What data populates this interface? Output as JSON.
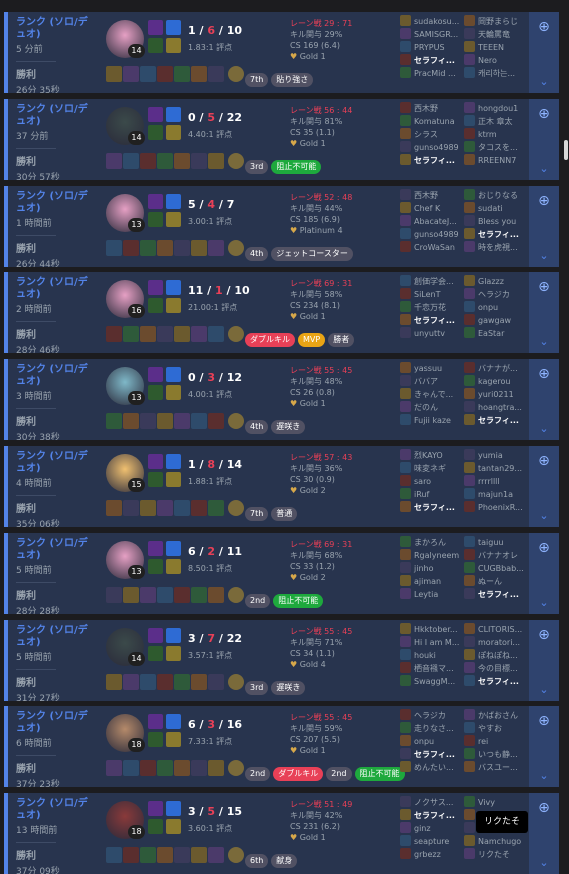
{
  "matches": [
    {
      "queue": "ランク (ソロ/デュオ)",
      "ago": "5 分前",
      "result": "勝利",
      "duration": "26分 35秒",
      "level": "14",
      "kills": "1",
      "deaths": "6",
      "assists": "10",
      "ratio": "1.83:1 評点",
      "placement": "7th",
      "badges": [
        {
          "label": "貼り強さ",
          "kind": "place"
        }
      ],
      "lane": "レーン戦 29 : 71",
      "kp": "キル関与 29%",
      "cs": "CS 169 (6.4)",
      "tier": "Gold 1",
      "team1": [
        "sudakosu...",
        "SAMISGR...",
        "PRYPUS",
        "セラフィ...",
        "PracMid ..."
      ],
      "team2": [
        "岡野まらじ",
        "天輪罵竜",
        "TEEEN",
        "Nero",
        "캐리하는..."
      ],
      "me_index": 3,
      "champ_color": "#e6a0c4"
    },
    {
      "queue": "ランク (ソロ/デュオ)",
      "ago": "37 分前",
      "result": "勝利",
      "duration": "30分 57秒",
      "level": "14",
      "kills": "0",
      "deaths": "5",
      "assists": "22",
      "ratio": "4.40:1 評点",
      "placement": "3rd",
      "badges": [
        {
          "label": "阻止不可能",
          "kind": "green"
        }
      ],
      "lane": "レーン戦 56 : 44",
      "kp": "キル関与 81%",
      "cs": "CS 35 (1.1)",
      "tier": "Gold 1",
      "team1": [
        "西木野",
        "Komatuna",
        "シラス",
        "gunso4989",
        "セラフィ..."
      ],
      "team2": [
        "hongdou1",
        "正木 章太",
        "ktrm",
        "タコスを...",
        "RREENN7"
      ],
      "me_index": 4,
      "champ_color": "#3b4a4a"
    },
    {
      "queue": "ランク (ソロ/デュオ)",
      "ago": "1 時間前",
      "result": "勝利",
      "duration": "26分 44秒",
      "level": "13",
      "kills": "5",
      "deaths": "4",
      "assists": "7",
      "ratio": "3.00:1 評点",
      "placement": "4th",
      "badges": [
        {
          "label": "ジェットコースター",
          "kind": "place"
        }
      ],
      "lane": "レーン戦 52 : 48",
      "kp": "キル関与 44%",
      "cs": "CS 185 (6.9)",
      "tier": "Platinum 4",
      "team1": [
        "西木野",
        "Chef K",
        "AbacateJ...",
        "gunso4989",
        "CroWaSan"
      ],
      "team2": [
        "おじりなる",
        "sudati",
        "Bless you",
        "セラフィ...",
        "時を虎視..."
      ],
      "me_index": 8,
      "champ_color": "#e6a0c4"
    },
    {
      "queue": "ランク (ソロ/デュオ)",
      "ago": "2 時間前",
      "result": "勝利",
      "duration": "28分 46秒",
      "level": "16",
      "kills": "11",
      "deaths": "1",
      "assists": "10",
      "ratio": "21.00:1 評点",
      "placement": "",
      "badges": [
        {
          "label": "ダブルキル",
          "kind": "multi"
        },
        {
          "label": "MVP",
          "kind": "mvp"
        },
        {
          "label": "勝者",
          "kind": "place"
        }
      ],
      "lane": "レーン戦 69 : 31",
      "kp": "キル関与 58%",
      "cs": "CS 234 (8.1)",
      "tier": "Gold 1",
      "team1": [
        "創価学会...",
        "SiLenT",
        "千恋万花",
        "セラフィ...",
        "unyuttv"
      ],
      "team2": [
        "Glazzz",
        "ヘラジカ",
        "onpu",
        "gawgaw",
        "EaStar"
      ],
      "me_index": 3,
      "champ_color": "#e6a0c4"
    },
    {
      "queue": "ランク (ソロ/デュオ)",
      "ago": "3 時間前",
      "result": "勝利",
      "duration": "30分 38秒",
      "level": "13",
      "kills": "0",
      "deaths": "3",
      "assists": "12",
      "ratio": "4.00:1 評点",
      "placement": "4th",
      "badges": [
        {
          "label": "遅咲き",
          "kind": "place"
        }
      ],
      "lane": "レーン戦 55 : 45",
      "kp": "キル関与 48%",
      "cs": "CS 26 (0.8)",
      "tier": "Gold 1",
      "team1": [
        "yassuu",
        "ババア",
        "きゃんで...",
        "だのん",
        "Fujii kaze"
      ],
      "team2": [
        "バナナが...",
        "kagerou",
        "yuri0211",
        "hoangtra...",
        "セラフィ..."
      ],
      "me_index": 9,
      "champ_color": "#7fb8c8"
    },
    {
      "queue": "ランク (ソロ/デュオ)",
      "ago": "4 時間前",
      "result": "勝利",
      "duration": "35分 06秒",
      "level": "15",
      "kills": "1",
      "deaths": "8",
      "assists": "14",
      "ratio": "1.88:1 評点",
      "placement": "7th",
      "badges": [
        {
          "label": "普通",
          "kind": "place"
        }
      ],
      "lane": "レーン戦 57 : 43",
      "kp": "キル関与 36%",
      "cs": "CS 30 (0.9)",
      "tier": "Gold 2",
      "team1": [
        "烈KAYO",
        "味変ネギ",
        "saro",
        "iRuf",
        "セラフィ..."
      ],
      "team2": [
        "yumia",
        "tantan29...",
        "rrrrllll",
        "majun1a",
        "PhoenixR..."
      ],
      "me_index": 4,
      "champ_color": "#f0c070"
    },
    {
      "queue": "ランク (ソロ/デュオ)",
      "ago": "5 時間前",
      "result": "勝利",
      "duration": "28分 28秒",
      "level": "13",
      "kills": "6",
      "deaths": "2",
      "assists": "11",
      "ratio": "8.50:1 評点",
      "placement": "2nd",
      "badges": [
        {
          "label": "阻止不可能",
          "kind": "green"
        }
      ],
      "lane": "レーン戦 69 : 31",
      "kp": "キル関与 68%",
      "cs": "CS 33 (1.2)",
      "tier": "Gold 2",
      "team1": [
        "まかろん",
        "Rgalyneem",
        "jinho",
        "ajiman",
        "Leytia"
      ],
      "team2": [
        "taiguu",
        "バナナオレ",
        "CUGBbab...",
        "ぬーん",
        "セラフィ..."
      ],
      "me_index": 9,
      "champ_color": "#e6a0c4"
    },
    {
      "queue": "ランク (ソロ/デュオ)",
      "ago": "5 時間前",
      "result": "勝利",
      "duration": "31分 27秒",
      "level": "14",
      "kills": "3",
      "deaths": "7",
      "assists": "22",
      "ratio": "3.57:1 評点",
      "placement": "3rd",
      "badges": [
        {
          "label": "遅咲き",
          "kind": "place"
        }
      ],
      "lane": "レーン戦 55 : 45",
      "kp": "キル関与 71%",
      "cs": "CS 34 (1.1)",
      "tier": "Gold 4",
      "team1": [
        "Hkktober...",
        "Hi I am M...",
        "houki",
        "栖音襁マ...",
        "SwaggM..."
      ],
      "team2": [
        "CLITORIS...",
        "moratori...",
        "ぽねぽね...",
        "今の目標...",
        "セラフィ..."
      ],
      "me_index": 9,
      "champ_color": "#3b4a4a"
    },
    {
      "queue": "ランク (ソロ/デュオ)",
      "ago": "6 時間前",
      "result": "勝利",
      "duration": "37分 23秒",
      "level": "18",
      "kills": "6",
      "deaths": "3",
      "assists": "16",
      "ratio": "7.33:1 評点",
      "placement": "2nd",
      "badges": [
        {
          "label": "ダブルキル",
          "kind": "multi"
        },
        {
          "label": "2nd",
          "kind": "place"
        },
        {
          "label": "阻止不可能",
          "kind": "green"
        }
      ],
      "lane": "レーン戦 55 : 45",
      "kp": "キル関与 59%",
      "cs": "CS 207 (5.5)",
      "tier": "Gold 1",
      "team1": [
        "ヘラジカ",
        "走りなさ...",
        "onpu",
        "セラフィ...",
        "めんたい..."
      ],
      "team2": [
        "かばおさん",
        "やすお",
        "rei",
        "いつも静...",
        "バスユー..."
      ],
      "me_index": 3,
      "champ_color": "#b58a6a"
    },
    {
      "queue": "ランク (ソロ/デュオ)",
      "ago": "13 時間前",
      "result": "勝利",
      "duration": "37分 09秒",
      "level": "18",
      "kills": "3",
      "deaths": "5",
      "assists": "15",
      "ratio": "3.60:1 評点",
      "placement": "6th",
      "badges": [
        {
          "label": "献身",
          "kind": "place"
        }
      ],
      "lane": "レーン戦 51 : 49",
      "kp": "キル関与 42%",
      "cs": "CS 231 (6.2)",
      "tier": "Gold 1",
      "team1": [
        "ノクサス...",
        "セラフィ...",
        "ginz",
        "seapture",
        "grbezz"
      ],
      "team2": [
        "Vivy",
        "Aa You",
        "リクたそ",
        "Namchugo",
        "リクたそ"
      ],
      "me_index": 1,
      "champ_color": "#8a3a3a"
    }
  ],
  "tooltip": "リクたそ",
  "icons": {
    "search": "search-plus-icon",
    "expand": "chevron-down-icon"
  }
}
